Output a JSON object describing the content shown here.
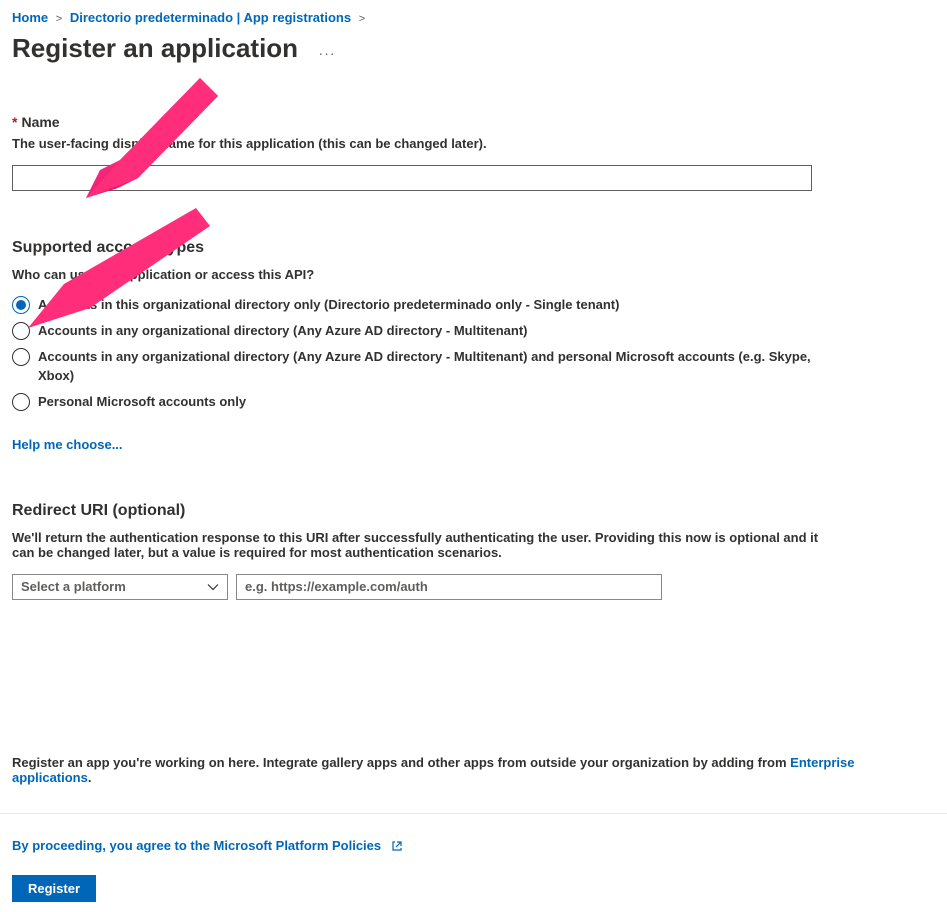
{
  "breadcrumb": {
    "home": "Home",
    "dir": "Directorio predeterminado | App registrations"
  },
  "page_title": "Register an application",
  "name_section": {
    "label": "Name",
    "desc": "The user-facing display name for this application (this can be changed later).",
    "value": ""
  },
  "account_types": {
    "heading": "Supported account types",
    "subtext": "Who can use this application or access this API?",
    "options": [
      "Accounts in this organizational directory only (Directorio predeterminado only - Single tenant)",
      "Accounts in any organizational directory (Any Azure AD directory - Multitenant)",
      "Accounts in any organizational directory (Any Azure AD directory - Multitenant) and personal Microsoft accounts (e.g. Skype, Xbox)",
      "Personal Microsoft accounts only"
    ],
    "selected_index": 0,
    "help_link": "Help me choose..."
  },
  "redirect_uri": {
    "heading": "Redirect URI (optional)",
    "desc": "We'll return the authentication response to this URI after successfully authenticating the user. Providing this now is optional and it can be changed later, but a value is required for most authentication scenarios.",
    "platform_placeholder": "Select a platform",
    "uri_placeholder": "e.g. https://example.com/auth"
  },
  "footer": {
    "outside_note_before": "Register an app you're working on here. Integrate gallery apps and other apps from outside your organization by adding from ",
    "outside_note_link": "Enterprise applications",
    "policy_text": "By proceeding, you agree to the Microsoft Platform Policies",
    "register_label": "Register"
  }
}
